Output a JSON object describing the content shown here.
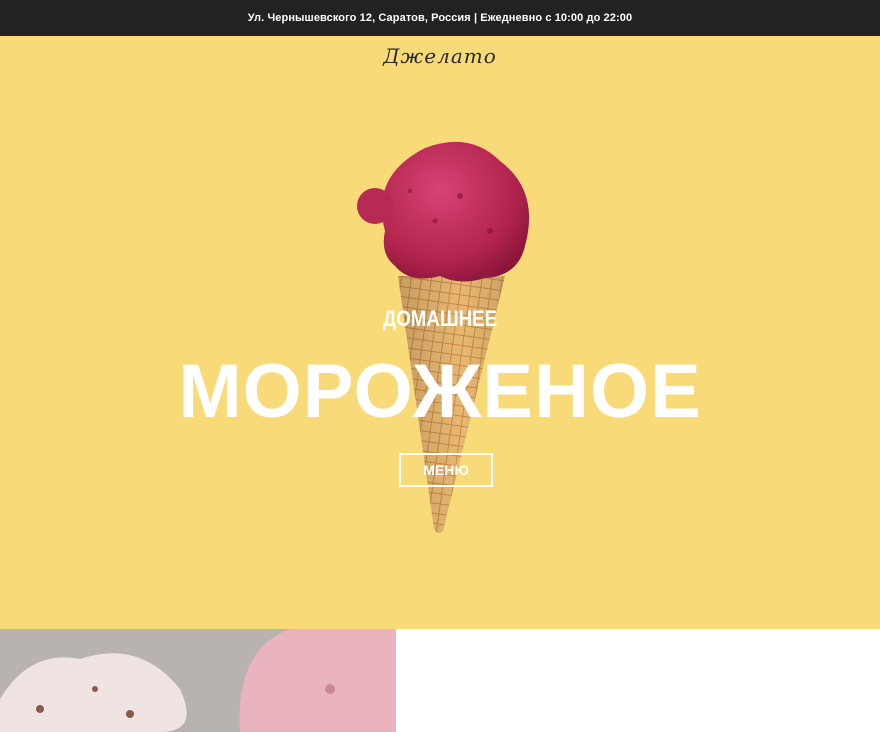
{
  "topbar": {
    "address_hours": "Ул. Чернышевского 12, Саратов, Россия | Ежедневно с 10:00 до 22:00"
  },
  "header": {
    "logo_text": "Джелато"
  },
  "hero": {
    "subtitle": "ДОМАШНЕЕ",
    "title": "МОРОЖЕНОЕ",
    "menu_button_label": "МЕНЮ",
    "image": "ice-cream-cone-photo"
  },
  "section_below": {
    "image": "ice-cream-scoops-photo"
  },
  "colors": {
    "hero_background": "#f8db78",
    "topbar_background": "#222222",
    "text_light": "#ffffff"
  }
}
